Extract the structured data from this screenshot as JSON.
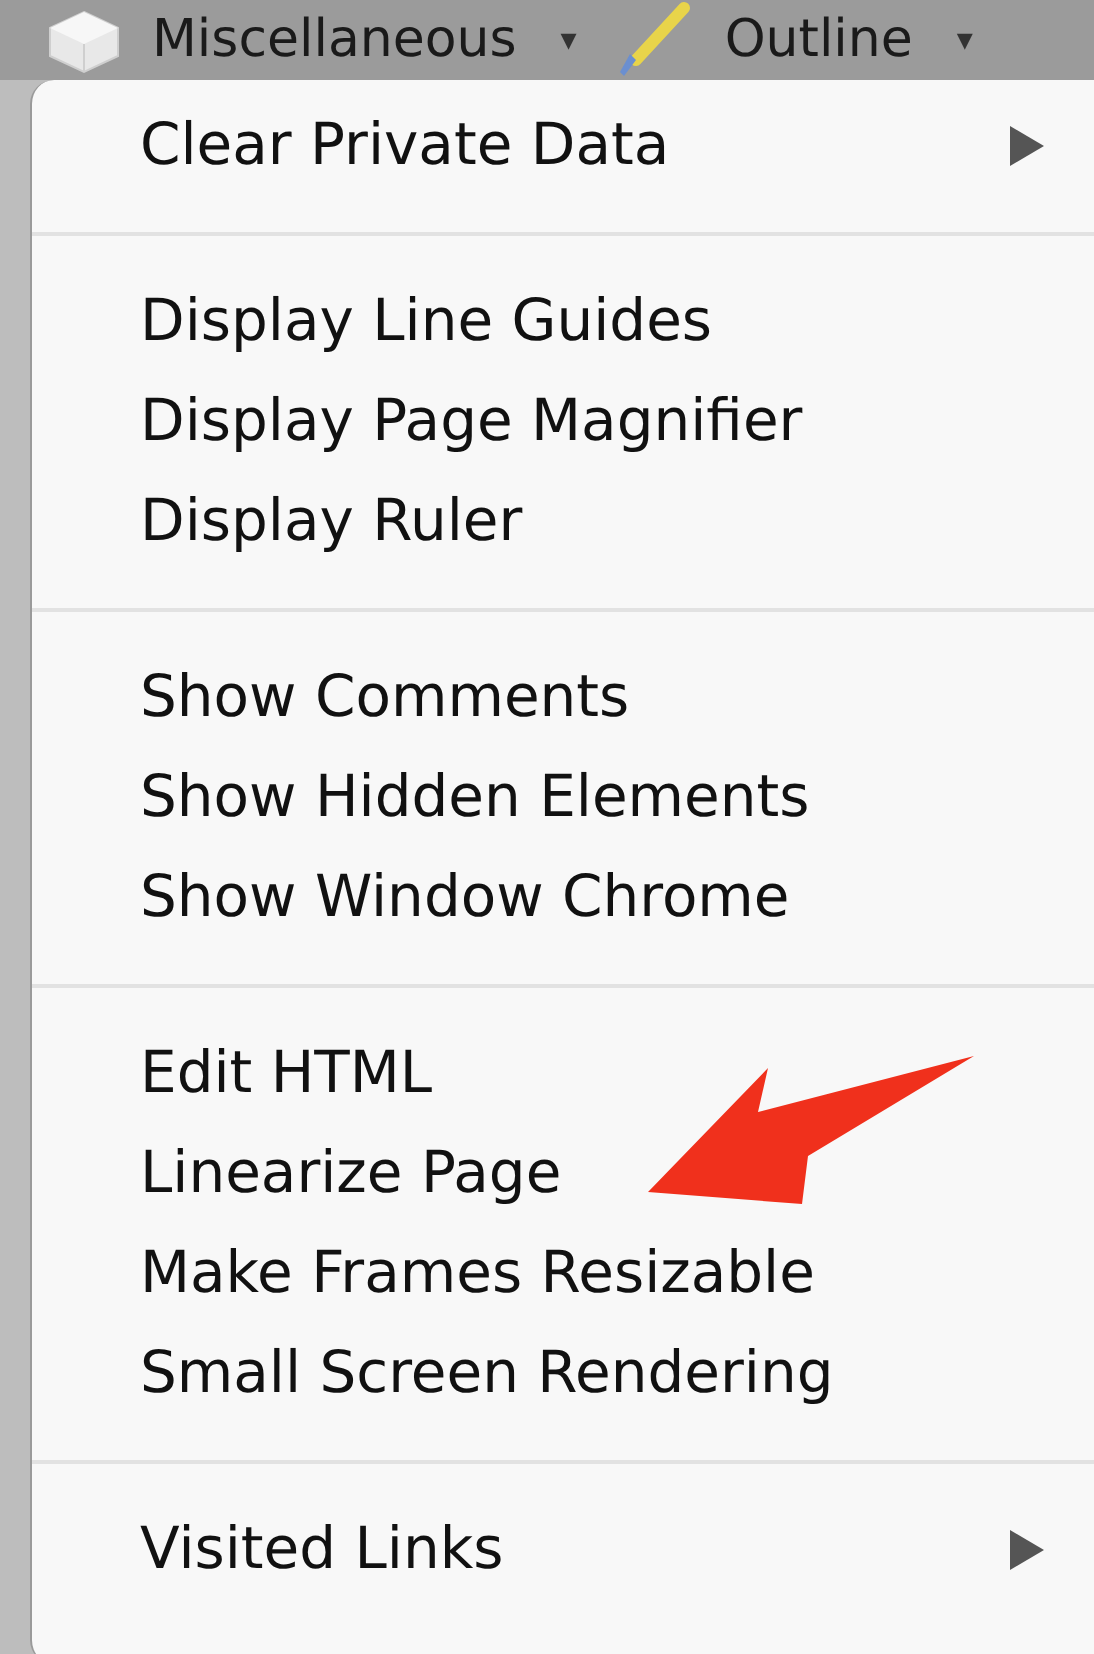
{
  "toolbar": {
    "items": [
      {
        "label": "Miscellaneous",
        "kind": "cube",
        "caret": "▾"
      },
      {
        "label": "Outline",
        "kind": "pencil",
        "caret": "▾"
      }
    ]
  },
  "menu": {
    "sections": [
      {
        "items": [
          {
            "label": "Clear Private Data",
            "kind": "submenu"
          }
        ]
      },
      {
        "items": [
          {
            "label": "Display Line Guides",
            "kind": "plain"
          },
          {
            "label": "Display Page Magnifier",
            "kind": "plain"
          },
          {
            "label": "Display Ruler",
            "kind": "plain"
          }
        ]
      },
      {
        "items": [
          {
            "label": "Show Comments",
            "kind": "plain"
          },
          {
            "label": "Show Hidden Elements",
            "kind": "plain"
          },
          {
            "label": "Show Window Chrome",
            "kind": "plain"
          }
        ]
      },
      {
        "items": [
          {
            "label": "Edit HTML",
            "kind": "plain"
          },
          {
            "label": "Linearize Page",
            "kind": "plain"
          },
          {
            "label": "Make Frames Resizable",
            "kind": "plain"
          },
          {
            "label": "Small Screen Rendering",
            "kind": "plain"
          }
        ]
      },
      {
        "items": [
          {
            "label": "Visited Links",
            "kind": "submenu"
          }
        ]
      }
    ]
  }
}
